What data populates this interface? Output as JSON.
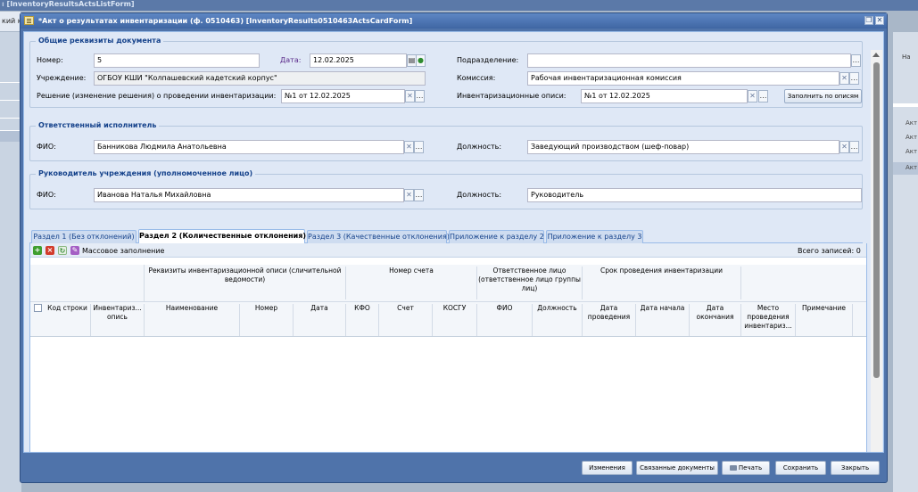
{
  "background": {
    "title": "[InventoryResultsActsListForm]",
    "tab_text": "кий ка",
    "right_header": "На",
    "right_rows": [
      "Акт",
      "Акт",
      "Акт",
      "Акт"
    ]
  },
  "window": {
    "title": "*Акт о результатах инвентаризации (ф. 0510463) [InventoryResults0510463ActsCardForm]",
    "restore_glyph": "❐",
    "close_glyph": "✕"
  },
  "section_general": {
    "legend": "Общие реквизиты документа",
    "number_label": "Номер:",
    "number_value": "5",
    "date_label": "Дата:",
    "date_value": "12.02.2025",
    "institution_label": "Учреждение:",
    "institution_value": "ОГБОУ КШИ \"Колпашевский кадетский корпус\"",
    "decision_label": "Решение (изменение решения) о проведении инвентаризации:",
    "decision_value": "№1 от 12.02.2025",
    "subdivision_label": "Подразделение:",
    "subdivision_value": "",
    "commission_label": "Комиссия:",
    "commission_value": "Рабочая инвентаризационная комиссия",
    "inventories_label": "Инвентаризационные описи:",
    "inventories_value": "№1 от 12.02.2025",
    "fill_button": "Заполнить по описям"
  },
  "section_responsible": {
    "legend": "Ответственный исполнитель",
    "fio_label": "ФИО:",
    "fio_value": "Банникова Людмила Анатольевна",
    "position_label": "Должность:",
    "position_value": "Заведующий производством (шеф-повар)"
  },
  "section_head": {
    "legend": "Руководитель учреждения (уполномоченное лицо)",
    "fio_label": "ФИО:",
    "fio_value": "Иванова Наталья Михайловна",
    "position_label": "Должность:",
    "position_value": "Руководитель"
  },
  "tabs": [
    {
      "label": "Раздел 1 (Без отклонений)",
      "active": false
    },
    {
      "label": "Раздел 2 (Количественные отклонения)",
      "active": true
    },
    {
      "label": "Раздел 3 (Качественные отклонения)",
      "active": false
    },
    {
      "label": "Приложение к разделу 2",
      "active": false
    },
    {
      "label": "Приложение к разделу 3",
      "active": false
    }
  ],
  "grid_toolbar": {
    "bulk_fill": "Массовое заполнение",
    "total_records": "Всего записей: 0"
  },
  "grid": {
    "group_headers": [
      "Реквизиты инвентаризационной описи (сличительной ведомости)",
      "Номер счета",
      "Ответственное лицо (ответственное лицо группы лиц)",
      "Срок проведения инвентаризации"
    ],
    "columns": [
      "Код строки",
      "Инвентариз... опись",
      "Наименование",
      "Номер",
      "Дата",
      "КФО",
      "Счет",
      "КОСГУ",
      "ФИО",
      "Должность",
      "Дата проведения",
      "Дата начала",
      "Дата окончания",
      "Место проведения инвентариз...",
      "Примечание"
    ],
    "rows": []
  },
  "footer": {
    "changes": "Изменения",
    "related": "Связанные документы",
    "print": "Печать",
    "save": "Сохранить",
    "close": "Закрыть"
  },
  "colors": {
    "window_frame": "#4f73aa",
    "panel_bg": "#dfe8f6",
    "legend_text": "#15428b",
    "add_icon": "#3f9e2f",
    "delete_icon": "#d23b2b",
    "refresh_icon": "#3a8f3a",
    "bulk_icon": "#a45fc4"
  }
}
